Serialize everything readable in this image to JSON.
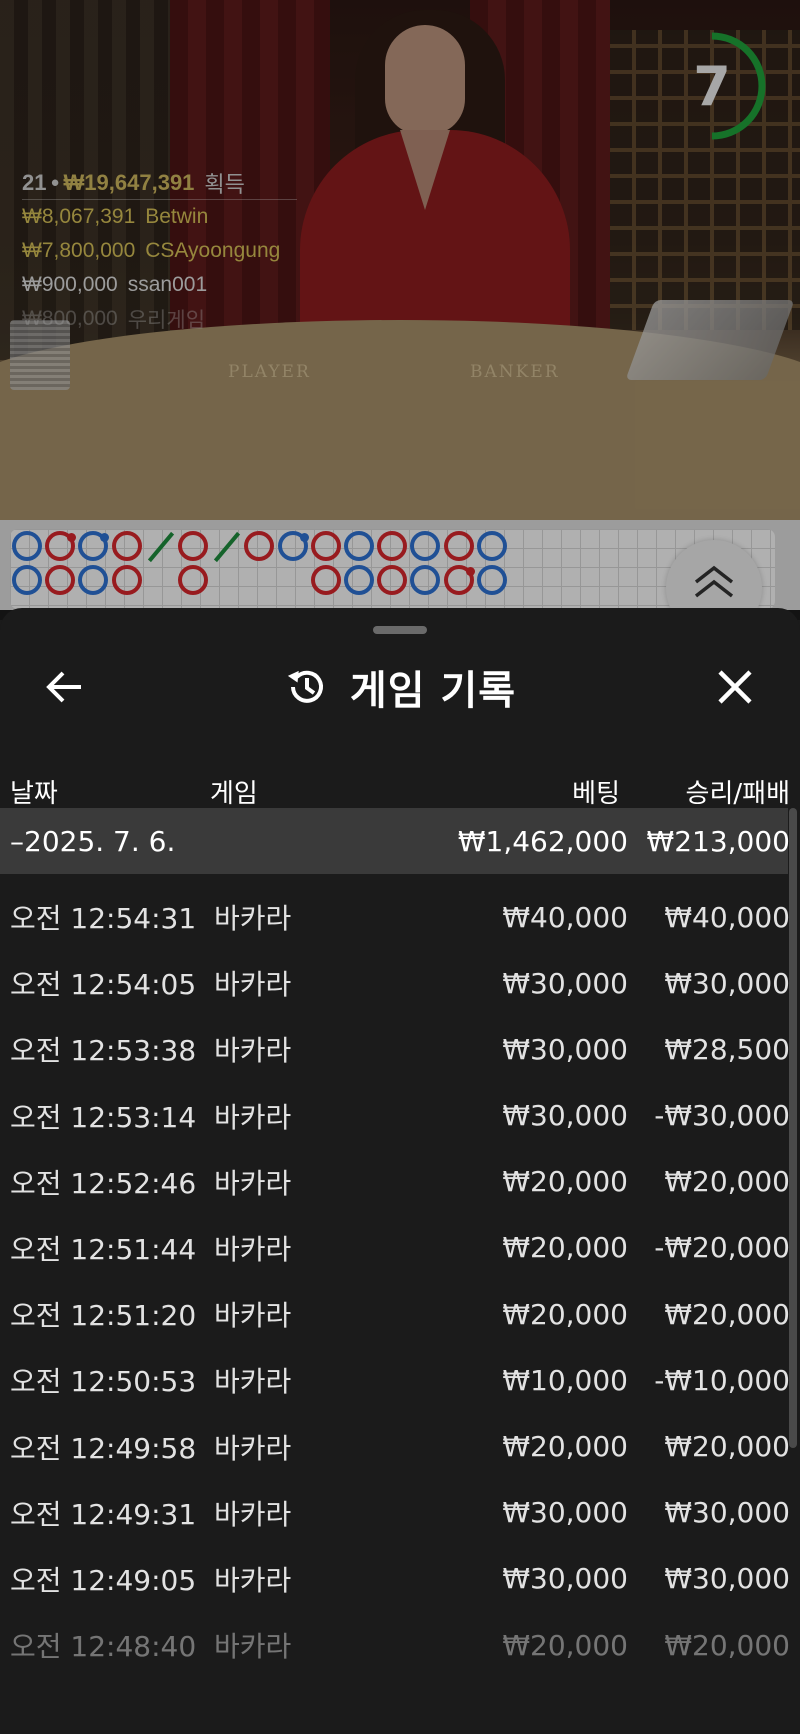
{
  "video": {
    "timer": "7",
    "table_labels": [
      "PLAYER",
      "BANKER"
    ],
    "winners": {
      "count": "21",
      "total": "₩19,647,391",
      "label": "획득",
      "list": [
        {
          "amount": "₩8,067,391",
          "name": "Betwin",
          "style": "gold"
        },
        {
          "amount": "₩7,800,000",
          "name": "CSAyoongung",
          "style": "gold"
        },
        {
          "amount": "₩900,000",
          "name": "ssan001",
          "style": "white"
        },
        {
          "amount": "₩800,000",
          "name": "우리게임",
          "style": "fade"
        }
      ]
    }
  },
  "road": {
    "row1": [
      "P",
      "B",
      "P",
      "B",
      "T",
      "B",
      "T",
      "B",
      "P",
      "B",
      "P",
      "B",
      "P",
      "B",
      "P"
    ],
    "row2": [
      "P",
      "B",
      "P",
      "B",
      "",
      "B",
      "",
      "",
      "",
      "B",
      "P",
      "B",
      "P",
      "B",
      "P"
    ],
    "colors": {
      "player": "#2d6fcf",
      "banker": "#d3262c",
      "tie": "#1e8a3c"
    }
  },
  "sheet": {
    "back_icon": "arrow-left-icon",
    "history_icon": "history-icon",
    "close_icon": "close-icon",
    "title": "게임 기록",
    "columns": {
      "date": "날짜",
      "game": "게임",
      "bet": "베팅",
      "result": "승리/패배"
    },
    "day": {
      "date": "–2025. 7. 6.",
      "bet": "₩1,462,000",
      "result": "₩213,000"
    },
    "rows": [
      {
        "time": "오전 12:54:31",
        "game": "바카라",
        "bet": "₩40,000",
        "result": "₩40,000"
      },
      {
        "time": "오전 12:54:05",
        "game": "바카라",
        "bet": "₩30,000",
        "result": "₩30,000"
      },
      {
        "time": "오전 12:53:38",
        "game": "바카라",
        "bet": "₩30,000",
        "result": "₩28,500"
      },
      {
        "time": "오전 12:53:14",
        "game": "바카라",
        "bet": "₩30,000",
        "result": "-₩30,000"
      },
      {
        "time": "오전 12:52:46",
        "game": "바카라",
        "bet": "₩20,000",
        "result": "₩20,000"
      },
      {
        "time": "오전 12:51:44",
        "game": "바카라",
        "bet": "₩20,000",
        "result": "-₩20,000"
      },
      {
        "time": "오전 12:51:20",
        "game": "바카라",
        "bet": "₩20,000",
        "result": "₩20,000"
      },
      {
        "time": "오전 12:50:53",
        "game": "바카라",
        "bet": "₩10,000",
        "result": "-₩10,000"
      },
      {
        "time": "오전 12:49:58",
        "game": "바카라",
        "bet": "₩20,000",
        "result": "₩20,000"
      },
      {
        "time": "오전 12:49:31",
        "game": "바카라",
        "bet": "₩30,000",
        "result": "₩30,000"
      },
      {
        "time": "오전 12:49:05",
        "game": "바카라",
        "bet": "₩30,000",
        "result": "₩30,000"
      },
      {
        "time": "오전 12:48:40",
        "game": "바카라",
        "bet": "₩20,000",
        "result": "₩20,000"
      }
    ]
  }
}
